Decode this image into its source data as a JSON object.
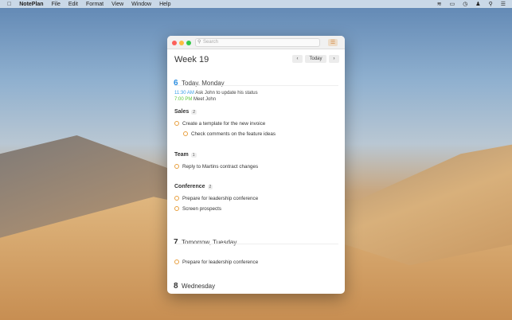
{
  "menubar": {
    "app": "NotePlan",
    "items": [
      "File",
      "Edit",
      "Format",
      "View",
      "Window",
      "Help"
    ],
    "status_icons": [
      "wifi-icon",
      "battery-icon",
      "clock-icon",
      "user-icon",
      "search-icon",
      "list-icon"
    ]
  },
  "window": {
    "search_placeholder": "Search",
    "title": "Week 19",
    "prev": "‹",
    "today": "Today",
    "next": "›"
  },
  "days": [
    {
      "num": "6",
      "label": "Today, Monday",
      "color": "#2a8de0"
    },
    {
      "num": "7",
      "label": "Tomorrow, Tuesday",
      "color": "#333333"
    },
    {
      "num": "8",
      "label": "Wednesday",
      "color": "#333333"
    }
  ],
  "events": [
    {
      "time": "11:30 AM",
      "text": "Ask John to update his status",
      "color": "#3aa0e8"
    },
    {
      "time": "7:00 PM",
      "text": "Meet John",
      "color": "#5cc83c"
    }
  ],
  "sections": [
    {
      "title": "Sales",
      "count": "2",
      "tasks": [
        "Create a template for the new invoice",
        "Check comments on the feature ideas"
      ]
    },
    {
      "title": "Team",
      "count": "1",
      "tasks": [
        "Reply to Martins contract changes"
      ]
    },
    {
      "title": "Conference",
      "count": "2",
      "tasks": [
        "Prepare for leadership conference",
        "Screen prospects"
      ]
    }
  ],
  "day7_tasks": [
    "Prepare for leadership conference"
  ],
  "colors": {
    "task_circle": "#e8a040",
    "accent": "#2a8de0"
  }
}
